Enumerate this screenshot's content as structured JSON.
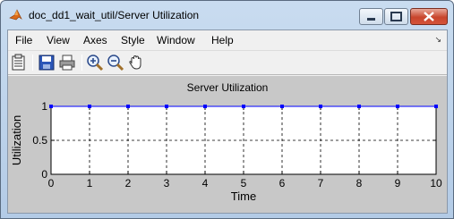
{
  "window": {
    "title": "doc_dd1_wait_util/Server Utilization",
    "app_icon": "matlab-icon"
  },
  "menu": {
    "items": [
      "File",
      "View",
      "Axes",
      "Style",
      "Window",
      "Help"
    ],
    "dock_icon": "dock-arrow-icon"
  },
  "toolbar": {
    "icons": [
      "parameters-icon",
      "save-icon",
      "print-icon",
      "zoom-in-icon",
      "zoom-out-icon",
      "pan-hand-icon"
    ]
  },
  "colors": {
    "line": "#0000ff",
    "background": "#c8c8c8",
    "axes_bg": "#ffffff"
  },
  "chart_data": {
    "type": "line",
    "title": "Server Utilization",
    "xlabel": "Time",
    "ylabel": "Utilization",
    "xlim": [
      0,
      10
    ],
    "ylim": [
      0,
      1
    ],
    "xticks": [
      "0",
      "1",
      "2",
      "3",
      "4",
      "5",
      "6",
      "7",
      "8",
      "9",
      "10"
    ],
    "yticks": [
      "0",
      "0.5",
      "1"
    ],
    "grid": true,
    "series": [
      {
        "x": [
          0,
          1,
          2,
          3,
          4,
          5,
          6,
          7,
          8,
          9,
          10
        ],
        "y": [
          1,
          1,
          1,
          1,
          1,
          1,
          1,
          1,
          1,
          1,
          1
        ]
      }
    ]
  }
}
